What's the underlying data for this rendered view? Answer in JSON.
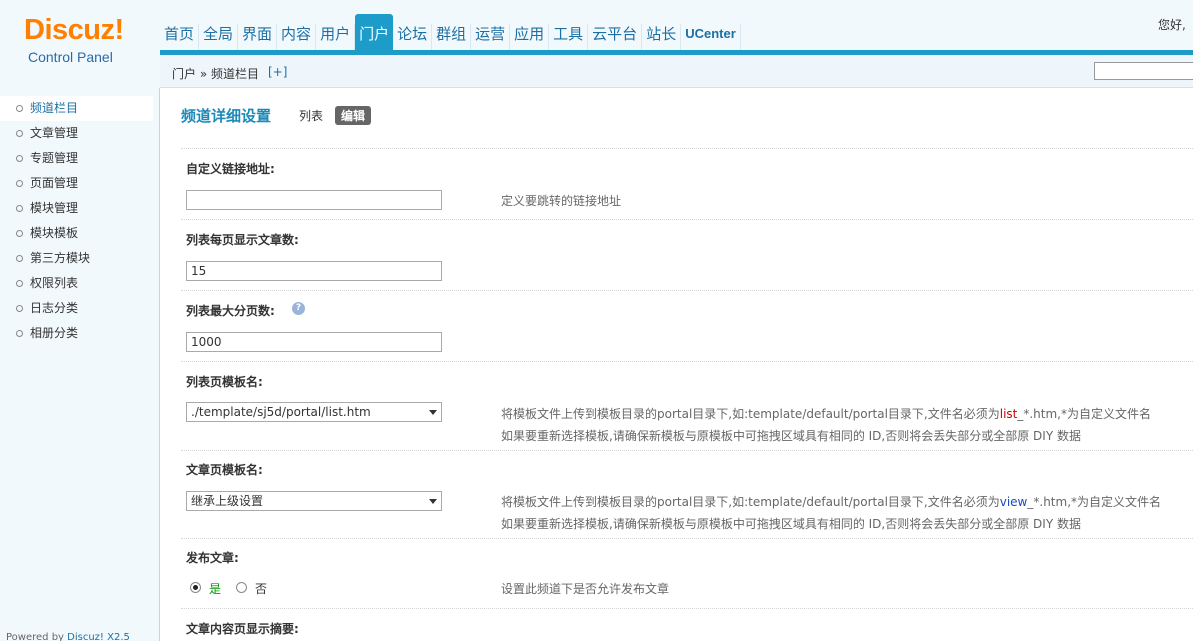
{
  "logo": {
    "brand": "Discuz!",
    "subtitle": "Control Panel"
  },
  "nav": {
    "items": [
      "首页",
      "全局",
      "界面",
      "内容",
      "用户",
      "门户",
      "论坛",
      "群组",
      "运营",
      "应用",
      "工具",
      "云平台",
      "站长",
      "UCenter"
    ],
    "active": "门户"
  },
  "greeting": "您好,",
  "breadcrumb": {
    "text": "门户 » 频道栏目",
    "add": "[+]"
  },
  "sidebar": {
    "items": [
      "频道栏目",
      "文章管理",
      "专题管理",
      "页面管理",
      "模块管理",
      "模块模板",
      "第三方模块",
      "权限列表",
      "日志分类",
      "相册分类"
    ],
    "active": "频道栏目",
    "powered_prefix": "Powered by ",
    "powered_name": "Discuz! X2.5"
  },
  "page": {
    "title": "频道详细设置",
    "tabs": [
      "列表",
      "编辑"
    ],
    "active_tab": "编辑"
  },
  "form": {
    "custom_url": {
      "label": "自定义链接地址:",
      "value": "",
      "tip": "定义要跳转的链接地址"
    },
    "per_page": {
      "label": "列表每页显示文章数:",
      "value": "15"
    },
    "max_pages": {
      "label": "列表最大分页数:",
      "value": "1000",
      "help_icon": "question-icon"
    },
    "list_tpl": {
      "label": "列表页模板名:",
      "value": "./template/sj5d/portal/list.htm",
      "tip1_a": "将模板文件上传到模板目录的portal目录下,如:template/default/portal目录下,文件名必须为",
      "tip1_red": "list",
      "tip1_b": "_*.htm,*为自定义文件名",
      "tip2": "如果要重新选择模板,请确保新模板与原模板中可拖拽区域具有相同的 ID,否则将会丢失部分或全部原 DIY 数据"
    },
    "article_tpl": {
      "label": "文章页模板名:",
      "value": "继承上级设置",
      "tip1_a": "将模板文件上传到模板目录的portal目录下,如:template/default/portal目录下,文件名必须为",
      "tip1_blue": "view",
      "tip1_b": "_*.htm,*为自定义文件名",
      "tip2": "如果要重新选择模板,请确保新模板与原模板中可拖拽区域具有相同的 ID,否则将会丢失部分或全部原 DIY 数据"
    },
    "publish": {
      "label": "发布文章:",
      "yes": "是",
      "no": "否",
      "selected": "是",
      "tip": "设置此频道下是否允许发布文章"
    },
    "summary": {
      "label": "文章内容页显示摘要:"
    }
  },
  "colors": {
    "accent": "#1d9cc9",
    "logo": "#ff7f00",
    "yes_label": "#009900"
  }
}
